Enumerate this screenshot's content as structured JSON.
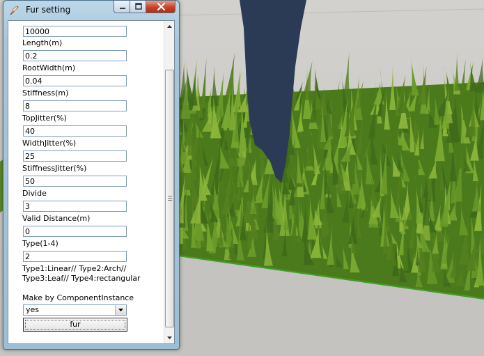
{
  "window": {
    "title": "Fur setting",
    "controls": [
      "minimize-icon",
      "maximize-icon",
      "close-icon"
    ]
  },
  "form": {
    "fields": [
      {
        "label": "",
        "value": "10000"
      },
      {
        "label": "Length(m)",
        "value": "0.2"
      },
      {
        "label": "RootWidth(m)",
        "value": "0.04"
      },
      {
        "label": "Stiffness(m)",
        "value": "8"
      },
      {
        "label": "TopJitter(%)",
        "value": "40"
      },
      {
        "label": "WidthJitter(%)",
        "value": "25"
      },
      {
        "label": "StiffnessJitter(%)",
        "value": "50"
      },
      {
        "label": "Divide",
        "value": "3"
      },
      {
        "label": "Valid Distance(m)",
        "value": "0"
      },
      {
        "label": "Type(1-4)",
        "value": "2"
      }
    ],
    "type_desc_line1": "Type1:Linear// Type2:Arch//",
    "type_desc_line2": "Type3:Leaf// Type4:rectangular",
    "component_label": "Make by ComponentInstance",
    "component_value": "yes",
    "submit_label": "fur"
  },
  "colors": {
    "titlebar": "#a7c6db",
    "viewport_bg": "#c9c8c4",
    "grass_dark": "#3f6a1a",
    "grass_light": "#8bb53a",
    "figure": "#2b3a55"
  }
}
